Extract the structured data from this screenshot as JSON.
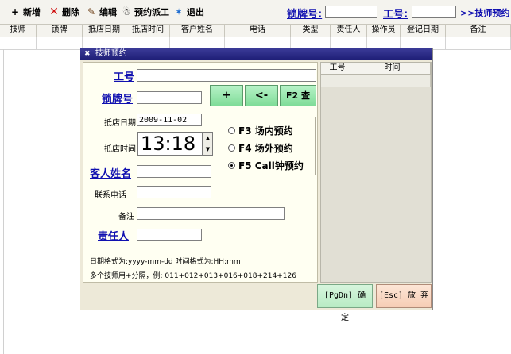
{
  "toolbar": {
    "new": "新增",
    "delete": "删除",
    "edit": "编辑",
    "dispatch": "预约派工",
    "exit": "退出",
    "key_label": "锁牌号:",
    "key_value": "",
    "id_label": "工号:",
    "id_value": "",
    "link": ">>技师预约"
  },
  "grid": {
    "columns": [
      "技师",
      "锁牌",
      "抵店日期",
      "抵店时间",
      "客户姓名",
      "电话",
      "类型",
      "责任人",
      "操作员",
      "登记日期",
      "备注"
    ]
  },
  "dialog": {
    "title": "技师预约",
    "id_label": "工号",
    "key_label": "锁牌号",
    "arrive_date_label": "抵店日期",
    "arrive_date_value": "2009-11-02",
    "arrive_time_label": "抵店时间",
    "arrive_time_value": "13:18",
    "customer_label": "客人姓名",
    "phone_label": "联系电话",
    "note_label": "备注",
    "owner_label": "责任人",
    "btn_plus": "+",
    "btn_back": "<-",
    "btn_query": "F2 查",
    "radio_onsite": "F3 场内预约",
    "radio_offsite": "F4 场外预约",
    "radio_call": "F5 Call钟预约",
    "hint_format": "日期格式为:yyyy-mm-dd   时间格式为:HH:mm",
    "hint_multi": "多个技师用+分隔，例: 011+012+013+016+018+214+126",
    "right_grid_col1": "工号",
    "right_grid_col2": "时间",
    "confirm": "[PgDn] 确 定",
    "cancel": "[Esc] 放 弃"
  },
  "colors": {
    "link_blue": "#1010b0",
    "title_bar": "#1d1d75",
    "green_button": "#7fdc98",
    "dialog_bg": "#ede9d8"
  }
}
